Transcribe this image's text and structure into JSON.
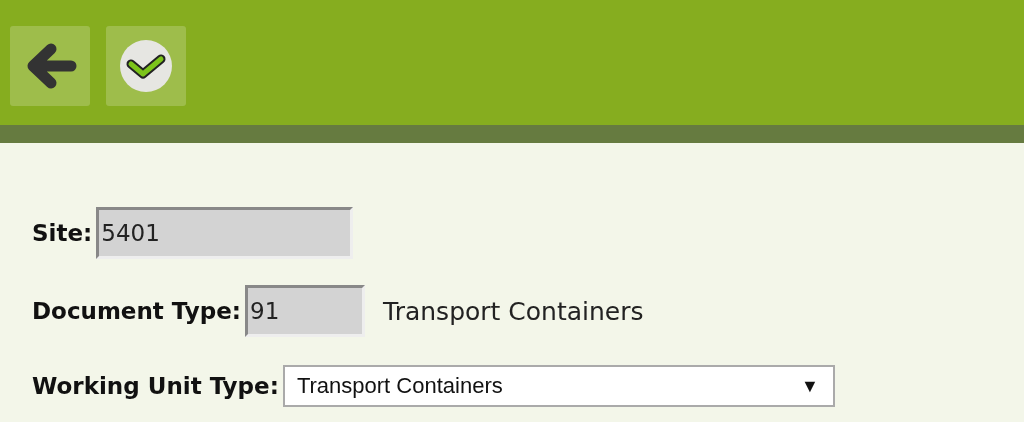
{
  "toolbar": {
    "buttons": [
      {
        "kind": "back"
      },
      {
        "kind": "confirm"
      }
    ]
  },
  "form": {
    "site": {
      "label": "Site:",
      "value": "5401"
    },
    "document_type": {
      "label": "Document Type:",
      "value": "91",
      "description": "Transport Containers"
    },
    "working_unit_type": {
      "label": "Working Unit Type:",
      "value": "Transport Containers",
      "arrow": "▼"
    }
  }
}
